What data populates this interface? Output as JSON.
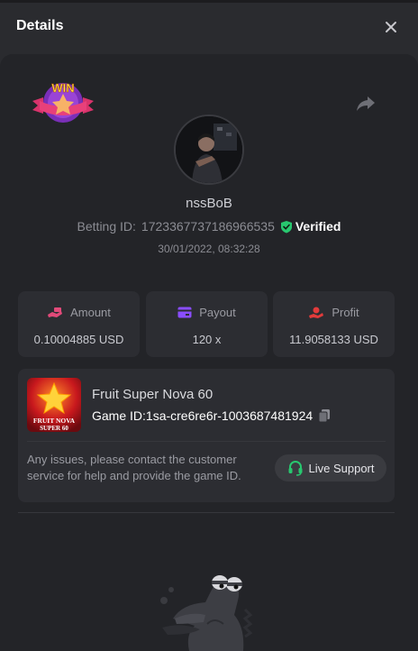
{
  "header": {
    "title": "Details",
    "close_icon": "close-icon"
  },
  "bet": {
    "username": "nssBoB",
    "betting_id_label": "Betting ID:",
    "betting_id": "1723367737186966535",
    "verified_label": "Verified",
    "date": "30/01/2022, 08:32:28"
  },
  "stats": {
    "amount": {
      "label": "Amount",
      "value": "0.10004885 USD",
      "icon": "money-hand-icon"
    },
    "payout": {
      "label": "Payout",
      "value": "120 x",
      "icon": "card-icon"
    },
    "profit": {
      "label": "Profit",
      "value": "11.9058133 USD",
      "icon": "profit-hand-icon"
    }
  },
  "game": {
    "name": "Fruit Super Nova 60",
    "game_id_label": "Game ID:",
    "game_id": "1sa-cre6re6r-1003687481924",
    "thumbnail_text": "FRUIT NOVA SUPER 60"
  },
  "support": {
    "notice": "Any issues, please contact the customer service for help and provide the game ID.",
    "button_label": "Live Support"
  },
  "badge_text": "WIN",
  "colors": {
    "accent_green": "#28c76f",
    "accent_pink": "#e24a7a",
    "accent_purple": "#8a4dff",
    "accent_red": "#e23b3b"
  }
}
